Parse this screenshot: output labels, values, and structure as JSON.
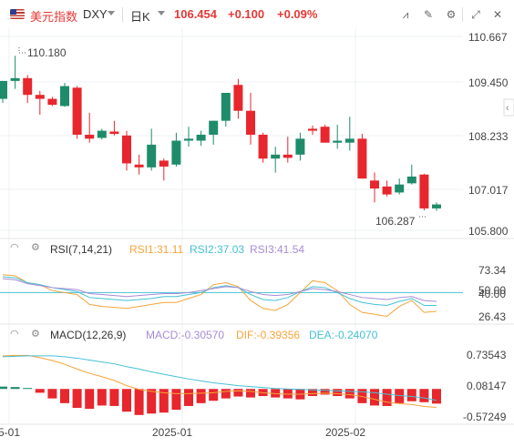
{
  "header": {
    "name": "美元指数",
    "symbol": "DXY",
    "timeframe": "日K",
    "price": "106.454",
    "change": "+0.100",
    "change_pct": "+0.09%"
  },
  "colors": {
    "up": "#1e8c6a",
    "down": "#e8262d",
    "rsi1": "#f5a43a",
    "rsi2": "#44c1d4",
    "rsi3": "#a78bd6",
    "dif": "#f5a43a",
    "dea": "#44c1d4",
    "grid": "#eef0f3"
  },
  "main": {
    "y_ticks": [
      "110.667",
      "109.450",
      "108.233",
      "107.017",
      "105.800"
    ],
    "high_label": "110.180",
    "low_label": "106.287"
  },
  "rsi": {
    "title": "RSI(7,14,21)",
    "rsi1_label": "RSI1:31.11",
    "rsi2_label": "RSI2:37.03",
    "rsi3_label": "RSI3:41.54",
    "y_ticks": [
      "73.34",
      "50.00",
      "40.00",
      "26.43"
    ]
  },
  "macd": {
    "title": "MACD(12,26,9)",
    "macd_label": "MACD:-0.30570",
    "dif_label": "DIF:-0.39356",
    "dea_label": "DEA:-0.24070",
    "y_ticks": [
      "0.73543",
      "0.08147",
      "-0.57249"
    ]
  },
  "x_axis": {
    "ticks": [
      "5-01",
      "2025-01",
      "2025-02"
    ]
  },
  "chart_data": {
    "type": "candlestick",
    "candles": [
      {
        "o": 109.1,
        "h": 109.55,
        "l": 109.0,
        "c": 109.55
      },
      {
        "o": 109.55,
        "h": 110.18,
        "l": 109.35,
        "c": 109.62
      },
      {
        "o": 109.62,
        "h": 109.7,
        "l": 109.0,
        "c": 109.2
      },
      {
        "o": 109.2,
        "h": 109.3,
        "l": 108.7,
        "c": 109.1
      },
      {
        "o": 109.1,
        "h": 109.15,
        "l": 108.92,
        "c": 108.95
      },
      {
        "o": 108.92,
        "h": 109.5,
        "l": 108.9,
        "c": 109.42
      },
      {
        "o": 109.38,
        "h": 109.42,
        "l": 108.1,
        "c": 108.2
      },
      {
        "o": 108.2,
        "h": 108.75,
        "l": 108.0,
        "c": 108.1
      },
      {
        "o": 108.12,
        "h": 108.35,
        "l": 108.08,
        "c": 108.3
      },
      {
        "o": 108.28,
        "h": 108.55,
        "l": 108.18,
        "c": 108.22
      },
      {
        "o": 108.18,
        "h": 108.3,
        "l": 107.3,
        "c": 107.48
      },
      {
        "o": 107.45,
        "h": 107.7,
        "l": 107.2,
        "c": 107.38
      },
      {
        "o": 107.38,
        "h": 108.35,
        "l": 107.3,
        "c": 107.95
      },
      {
        "o": 107.55,
        "h": 107.6,
        "l": 107.05,
        "c": 107.4
      },
      {
        "o": 107.45,
        "h": 108.25,
        "l": 107.4,
        "c": 108.05
      },
      {
        "o": 108.05,
        "h": 108.4,
        "l": 107.9,
        "c": 108.1
      },
      {
        "o": 108.05,
        "h": 108.3,
        "l": 107.92,
        "c": 108.2
      },
      {
        "o": 108.2,
        "h": 108.55,
        "l": 107.95,
        "c": 108.55
      },
      {
        "o": 108.55,
        "h": 109.25,
        "l": 108.4,
        "c": 109.25
      },
      {
        "o": 109.45,
        "h": 109.6,
        "l": 108.6,
        "c": 108.8
      },
      {
        "o": 108.8,
        "h": 109.25,
        "l": 107.95,
        "c": 108.2
      },
      {
        "o": 108.2,
        "h": 108.25,
        "l": 107.5,
        "c": 107.6
      },
      {
        "o": 107.6,
        "h": 107.9,
        "l": 107.25,
        "c": 107.7
      },
      {
        "o": 107.7,
        "h": 108.15,
        "l": 107.5,
        "c": 107.62
      },
      {
        "o": 107.7,
        "h": 108.25,
        "l": 107.55,
        "c": 108.1
      },
      {
        "o": 108.35,
        "h": 108.43,
        "l": 108.2,
        "c": 108.3
      },
      {
        "o": 108.4,
        "h": 108.45,
        "l": 108.05,
        "c": 108.0
      },
      {
        "o": 108.0,
        "h": 108.45,
        "l": 107.85,
        "c": 108.05
      },
      {
        "o": 108.0,
        "h": 108.65,
        "l": 107.8,
        "c": 108.1
      },
      {
        "o": 108.1,
        "h": 108.22,
        "l": 107.1,
        "c": 107.1
      },
      {
        "o": 107.05,
        "h": 107.25,
        "l": 106.5,
        "c": 106.85
      },
      {
        "o": 106.9,
        "h": 107.05,
        "l": 106.65,
        "c": 106.7
      },
      {
        "o": 106.75,
        "h": 107.1,
        "l": 106.7,
        "c": 106.95
      },
      {
        "o": 106.98,
        "h": 107.45,
        "l": 106.95,
        "c": 107.15
      },
      {
        "o": 107.2,
        "h": 107.22,
        "l": 106.3,
        "c": 106.35
      },
      {
        "o": 106.35,
        "h": 106.5,
        "l": 106.29,
        "c": 106.45
      }
    ],
    "rsi1": [
      68,
      67,
      60,
      58,
      52,
      50,
      48,
      38,
      36,
      35,
      34,
      36,
      38,
      40,
      40,
      44,
      48,
      58,
      60,
      56,
      42,
      34,
      32,
      38,
      50,
      62,
      60,
      52,
      38,
      30,
      28,
      26,
      36,
      42,
      30,
      31
    ],
    "rsi2": [
      66,
      65,
      60,
      58,
      55,
      53,
      51,
      45,
      44,
      43,
      42,
      43,
      44,
      46,
      46,
      48,
      50,
      55,
      57,
      55,
      48,
      43,
      42,
      45,
      51,
      56,
      55,
      50,
      44,
      40,
      38,
      37,
      41,
      44,
      37,
      37
    ],
    "rsi3": [
      64,
      63,
      59,
      57,
      55,
      54,
      53,
      49,
      48,
      47,
      46,
      47,
      48,
      49,
      49,
      50,
      52,
      54,
      56,
      55,
      51,
      48,
      47,
      48,
      51,
      54,
      53,
      51,
      48,
      45,
      44,
      43,
      45,
      46,
      42,
      41
    ],
    "macd_hist": [
      0.05,
      0.04,
      0.02,
      -0.08,
      -0.2,
      -0.3,
      -0.4,
      -0.42,
      -0.35,
      -0.36,
      -0.48,
      -0.55,
      -0.52,
      -0.5,
      -0.44,
      -0.36,
      -0.3,
      -0.25,
      -0.2,
      -0.16,
      -0.18,
      -0.15,
      -0.18,
      -0.2,
      -0.22,
      -0.15,
      -0.12,
      -0.15,
      -0.2,
      -0.3,
      -0.35,
      -0.36,
      -0.3,
      -0.26,
      -0.28,
      -0.31
    ],
    "dif": [
      0.7,
      0.71,
      0.71,
      0.66,
      0.6,
      0.52,
      0.42,
      0.33,
      0.26,
      0.18,
      0.07,
      -0.01,
      -0.05,
      -0.08,
      -0.1,
      -0.1,
      -0.09,
      -0.08,
      -0.05,
      -0.04,
      -0.05,
      -0.08,
      -0.1,
      -0.11,
      -0.11,
      -0.1,
      -0.09,
      -0.1,
      -0.12,
      -0.16,
      -0.22,
      -0.28,
      -0.31,
      -0.33,
      -0.37,
      -0.39
    ],
    "dea": [
      0.68,
      0.69,
      0.7,
      0.7,
      0.7,
      0.68,
      0.65,
      0.61,
      0.57,
      0.53,
      0.47,
      0.42,
      0.36,
      0.31,
      0.26,
      0.21,
      0.17,
      0.13,
      0.1,
      0.07,
      0.05,
      0.03,
      0.01,
      0.0,
      -0.01,
      -0.02,
      -0.03,
      -0.04,
      -0.05,
      -0.06,
      -0.08,
      -0.11,
      -0.14,
      -0.16,
      -0.19,
      -0.24
    ]
  }
}
